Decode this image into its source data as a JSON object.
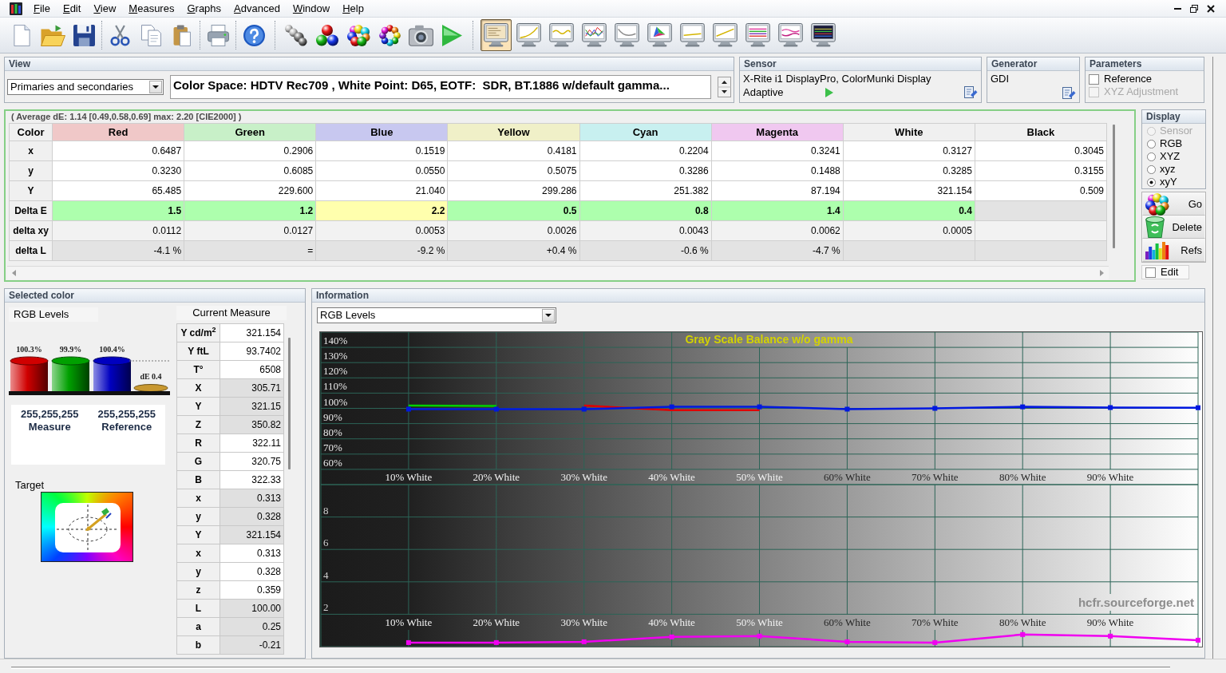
{
  "menu": [
    "File",
    "Edit",
    "View",
    "Measures",
    "Graphs",
    "Advanced",
    "Window",
    "Help"
  ],
  "graph_buttons": [
    {
      "selected": true
    },
    {
      "selected": false
    },
    {
      "selected": false
    },
    {
      "selected": false
    },
    {
      "selected": false
    },
    {
      "selected": false
    },
    {
      "selected": false
    },
    {
      "selected": false
    },
    {
      "selected": false
    },
    {
      "selected": false
    },
    {
      "selected": false
    }
  ],
  "view": {
    "title": "View",
    "mode": "Primaries and secondaries",
    "description": "Color Space: HDTV Rec709 , White Point: D65, EOTF:  SDR, BT.1886 w/default gamma..."
  },
  "sensor": {
    "title": "Sensor",
    "device": "X-Rite i1 DisplayPro, ColorMunki Display",
    "mode": "Adaptive"
  },
  "generator": {
    "title": "Generator",
    "name": "GDI"
  },
  "parameters": {
    "title": "Parameters",
    "options": [
      {
        "label": "Reference",
        "checked": false,
        "disabled": false
      },
      {
        "label": "XYZ Adjustment",
        "checked": false,
        "disabled": true
      }
    ]
  },
  "measures_table": {
    "summary": "( Average dE: 1.14 [0.49,0.58,0.69] max: 2.20 [CIE2000] )",
    "corner_label": "Color",
    "columns": [
      {
        "label": "Red",
        "color": "#f0c8c8"
      },
      {
        "label": "Green",
        "color": "#c8f0c8"
      },
      {
        "label": "Blue",
        "color": "#c8c8f0"
      },
      {
        "label": "Yellow",
        "color": "#f0f0c8"
      },
      {
        "label": "Cyan",
        "color": "#c8f0f0"
      },
      {
        "label": "Magenta",
        "color": "#f0c8f0"
      },
      {
        "label": "White"
      },
      {
        "label": "Black"
      }
    ],
    "rows": [
      {
        "label": "x",
        "kind": "measure",
        "cells": [
          "0.6487",
          "0.2906",
          "0.1519",
          "0.4181",
          "0.2204",
          "0.3241",
          "0.3127",
          "0.3045"
        ]
      },
      {
        "label": "y",
        "kind": "measure",
        "cells": [
          "0.3230",
          "0.6085",
          "0.0550",
          "0.5075",
          "0.3286",
          "0.1488",
          "0.3285",
          "0.3155"
        ]
      },
      {
        "label": "Y",
        "kind": "measure",
        "cells": [
          "65.485",
          "229.600",
          "21.040",
          "299.286",
          "251.382",
          "87.194",
          "321.154",
          "0.509"
        ]
      },
      {
        "label": "Delta E",
        "kind": "delta_e",
        "cells": [
          {
            "text": "1.5",
            "color": "#adffad"
          },
          {
            "text": "1.2",
            "color": "#adffad"
          },
          {
            "text": "2.2",
            "color": "#ffffad"
          },
          {
            "text": "0.5",
            "color": "#adffad"
          },
          {
            "text": "0.8",
            "color": "#adffad"
          },
          {
            "text": "1.4",
            "color": "#adffad"
          },
          {
            "text": "0.4",
            "color": "#adffad"
          }
        ]
      },
      {
        "label": "delta xy",
        "kind": "delta",
        "cells": [
          "0.0112",
          "0.0127",
          "0.0053",
          "0.0026",
          "0.0043",
          "0.0062",
          "0.0005"
        ]
      },
      {
        "label": "delta L",
        "kind": "delta",
        "cells": [
          "-4.1 %",
          "=",
          "-9.2 %",
          "+0.4 %",
          "-0.6 %",
          "-4.7 %"
        ]
      }
    ]
  },
  "display": {
    "title": "Display",
    "options": [
      {
        "label": "Sensor",
        "selected": false,
        "disabled": true
      },
      {
        "label": "RGB",
        "selected": false,
        "disabled": false
      },
      {
        "label": "XYZ",
        "selected": false,
        "disabled": false
      },
      {
        "label": "xyz",
        "selected": false,
        "disabled": false
      },
      {
        "label": "xyY",
        "selected": true,
        "disabled": false
      }
    ]
  },
  "actions": [
    {
      "label": "Go"
    },
    {
      "label": "Delete"
    },
    {
      "label": "Refs"
    }
  ],
  "edit": {
    "label": "Edit",
    "checked": false
  },
  "selected_color": {
    "title": "Selected color",
    "levels_label": "RGB Levels",
    "bars": [
      {
        "label": "100.3%",
        "color": "#d00000"
      },
      {
        "label": "99.9%",
        "color": "#00a000"
      },
      {
        "label": "100.4%",
        "color": "#0000c0"
      }
    ],
    "delta_e": {
      "label": "dE 0.4",
      "color": "#c89830"
    },
    "measure": {
      "value": "255,255,255",
      "label": "Measure"
    },
    "reference": {
      "value": "255,255,255",
      "label": "Reference"
    },
    "target_label": "Target"
  },
  "current_measure": {
    "title": "Current Measure",
    "rows": [
      {
        "label": "Y cd/m$^{2}$",
        "value": "321.154"
      },
      {
        "label": "Y ftL",
        "value": "93.7402"
      },
      {
        "label": "T°",
        "value": "6508"
      },
      {
        "label": "X",
        "value": "305.71"
      },
      {
        "label": "Y",
        "value": "321.15"
      },
      {
        "label": "Z",
        "value": "350.82"
      },
      {
        "label": "R",
        "value": "322.11"
      },
      {
        "label": "G",
        "value": "320.75"
      },
      {
        "label": "B",
        "value": "322.33"
      },
      {
        "label": "x",
        "value": "0.313"
      },
      {
        "label": "y",
        "value": "0.328"
      },
      {
        "label": "Y",
        "value": "321.154"
      },
      {
        "label": "x",
        "value": "0.313"
      },
      {
        "label": "y",
        "value": "0.328"
      },
      {
        "label": "z",
        "value": "0.359"
      },
      {
        "label": "L",
        "value": "100.00"
      },
      {
        "label": "a",
        "value": "0.25"
      },
      {
        "label": "b",
        "value": "-0.21"
      }
    ]
  },
  "information": {
    "title": "Information",
    "view": "RGB Levels",
    "rgb_chart": {
      "chart_data": {
        "type": "line",
        "title": "Gray Scale Balance w/o gamma",
        "x": [
          10,
          20,
          30,
          40,
          50,
          60,
          70,
          80,
          90,
          100
        ],
        "xlim": [
          0,
          100
        ],
        "ylim": [
          50,
          150
        ],
        "xticks": [
          {
            "value": 10,
            "label": "10% White"
          },
          {
            "value": 20,
            "label": "20% White"
          },
          {
            "value": 30,
            "label": "30% White"
          },
          {
            "value": 40,
            "label": "40% White"
          },
          {
            "value": 50,
            "label": "50% White"
          },
          {
            "value": 60,
            "label": "60% White"
          },
          {
            "value": 70,
            "label": "70% White"
          },
          {
            "value": 80,
            "label": "80% White"
          },
          {
            "value": 90,
            "label": "90% White"
          }
        ],
        "yticks": [
          {
            "value": 60,
            "label": "60%"
          },
          {
            "value": 70,
            "label": "70%"
          },
          {
            "value": 80,
            "label": "80%"
          },
          {
            "value": 90,
            "label": "90%"
          },
          {
            "value": 100,
            "label": "100%"
          },
          {
            "value": 110,
            "label": "110%"
          },
          {
            "value": 120,
            "label": "120%"
          },
          {
            "value": 130,
            "label": "130%"
          },
          {
            "value": 140,
            "label": "140%"
          }
        ],
        "grid": true,
        "series": [
          {
            "color": "#00d000",
            "values": [
              101.8,
              101.5,
              null,
              null,
              null,
              null,
              null,
              null,
              null,
              null
            ]
          },
          {
            "color": "#e00000",
            "values": [
              null,
              null,
              101.8,
              98.8,
              98.8,
              null,
              null,
              null,
              null,
              null
            ]
          },
          {
            "color": "#0018e0",
            "marker": "square",
            "values": [
              99.5,
              99.5,
              99.5,
              101,
              101,
              99.5,
              100,
              101,
              100.5,
              100.4
            ]
          }
        ]
      }
    },
    "delta_e_chart": {
      "chart_data": {
        "type": "line",
        "x": [
          10,
          20,
          30,
          40,
          50,
          60,
          70,
          80,
          90,
          100
        ],
        "xlim": [
          0,
          100
        ],
        "ylim": [
          0,
          10
        ],
        "xticks": [
          {
            "value": 10,
            "label": "10% White"
          },
          {
            "value": 20,
            "label": "20% White"
          },
          {
            "value": 30,
            "label": "30% White"
          },
          {
            "value": 40,
            "label": "40% White"
          },
          {
            "value": 50,
            "label": "50% White"
          },
          {
            "value": 60,
            "label": "60% White"
          },
          {
            "value": 70,
            "label": "70% White"
          },
          {
            "value": 80,
            "label": "80% White"
          },
          {
            "value": 90,
            "label": "90% White"
          }
        ],
        "yticks": [
          2,
          4,
          6,
          8
        ],
        "grid": true,
        "series": [
          {
            "color": "#f000f0",
            "marker": "square",
            "values": [
              0.25,
              0.25,
              0.3,
              0.6,
              0.65,
              0.3,
              0.25,
              0.75,
              0.65,
              0.4
            ]
          }
        ]
      }
    },
    "credit": "hcfr.sourceforge.net"
  }
}
